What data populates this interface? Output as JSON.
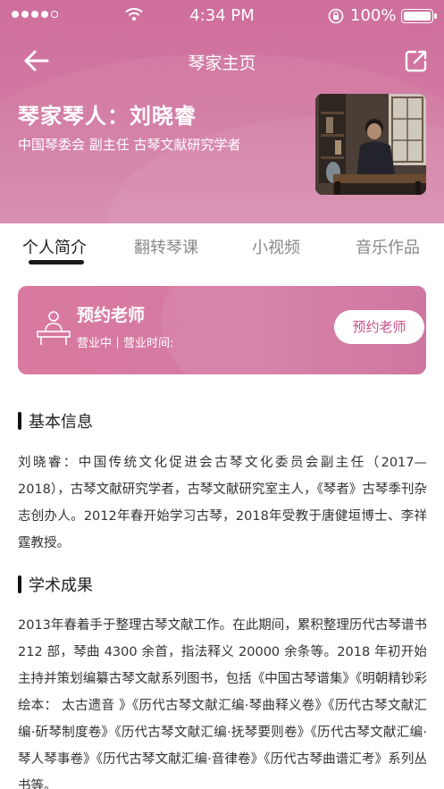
{
  "status_bar": {
    "time": "4:34 PM",
    "battery": "100%"
  },
  "nav": {
    "title": "琴家主页",
    "back_icon": "arrow-left-icon",
    "share_icon": "share-icon"
  },
  "profile": {
    "name": "琴家琴人：刘晓睿",
    "titles": "中国琴委会 副主任 古琴文献研究学者"
  },
  "tabs": [
    {
      "label": "个人简介",
      "active": true
    },
    {
      "label": "翻转琴课",
      "active": false
    },
    {
      "label": "小视频",
      "active": false
    },
    {
      "label": "音乐作品",
      "active": false
    }
  ],
  "booking": {
    "title": "预约老师",
    "status": "营业中",
    "hours_label": "营业时间:",
    "button": "预约老师"
  },
  "sections": [
    {
      "heading": "基本信息",
      "text": "刘晓睿：中国传统文化促进会古琴文化委员会副主任（2017—2018），古琴文献研究学者，古琴文献研究室主人，《琴者》古琴季刊杂志创办人。2012年春开始学习古琴，2018年受教于唐健垣博士、李祥霆教授。"
    },
    {
      "heading": "学术成果",
      "text": "2013年春着手于整理古琴文献工作。在此期间，累积整理历代古琴谱书 212 部，琴曲 4300 余首，指法释义 20000 余条等。2018 年初开始主持并策划编纂古琴文献系列图书，包括《中国古琴谱集》《明朝精钞彩绘本： 太古遗音 》《历代古琴文献汇编·琴曲释义卷》《历代古琴文献汇编·斫琴制度卷》《历代古琴文献汇编·抚琴要则卷》《历代古琴文献汇编·琴人琴事卷》《历代古琴文献汇编·音律卷》《历代古琴曲谱汇考》系列丛书等。"
    }
  ],
  "colors": {
    "header": "#cf6e9c",
    "accent_text": "#c65189",
    "active_tab": "#222222"
  }
}
